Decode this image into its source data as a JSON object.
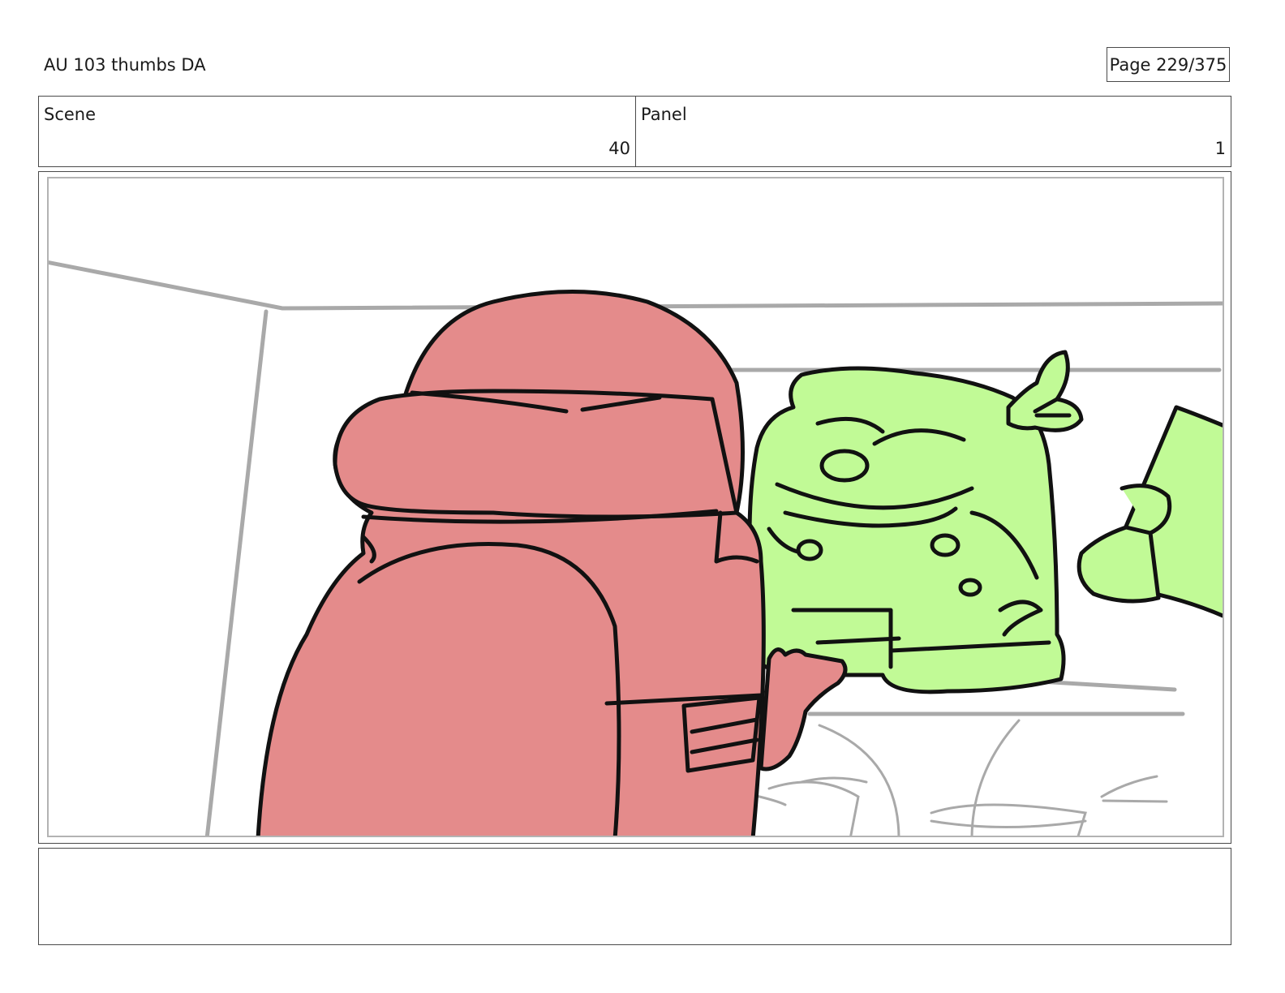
{
  "header": {
    "title": "AU 103 thumbs DA",
    "page_label": "Page 229/375"
  },
  "info": {
    "scene_label": "Scene",
    "scene_value": "40",
    "panel_label": "Panel",
    "panel_value": "1"
  },
  "panel_art": {
    "red_character_color": "#e48b8b",
    "green_character_color": "#c1fa96",
    "line_color": "#111111",
    "sketch_line_color": "#a9a9a9",
    "frame_color": "#b3b3b3"
  },
  "notes": {
    "text": ""
  }
}
